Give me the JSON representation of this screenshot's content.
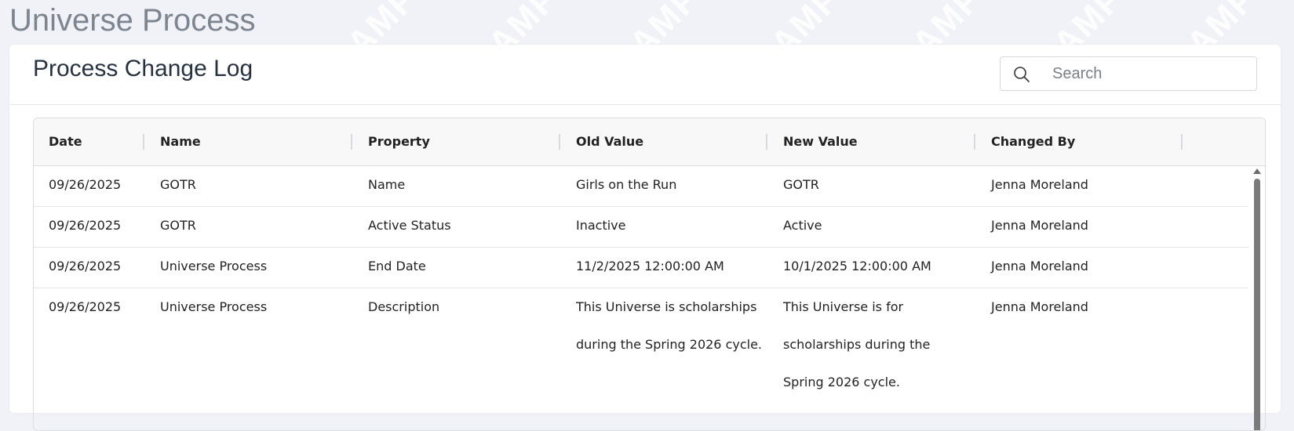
{
  "page": {
    "title": "Universe Process",
    "watermark_text": "SAMPLE"
  },
  "card": {
    "title": "Process Change Log"
  },
  "search": {
    "placeholder": "Search",
    "value": ""
  },
  "table": {
    "columns": [
      "Date",
      "Name",
      "Property",
      "Old Value",
      "New Value",
      "Changed By"
    ],
    "rows": [
      [
        "09/26/2025",
        "GOTR",
        "Name",
        "Girls on the Run",
        "GOTR",
        "Jenna Moreland"
      ],
      [
        "09/26/2025",
        "GOTR",
        "Active Status",
        "Inactive",
        "Active",
        "Jenna Moreland"
      ],
      [
        "09/26/2025",
        "Universe Process",
        "End Date",
        "11/2/2025 12:00:00 AM",
        "10/1/2025 12:00:00 AM",
        "Jenna Moreland"
      ],
      [
        "09/26/2025",
        "Universe Process",
        "Description",
        "This Universe is scholarships during the Spring 2026 cycle.",
        "This Universe is for scholarships during the Spring 2026 cycle.",
        "Jenna Moreland"
      ]
    ]
  },
  "colors": {
    "background": "#f1f2f7",
    "title_gray": "#7d8590",
    "header_bg": "#f8f8f9"
  },
  "icons": {
    "search": "search-icon",
    "scroll_up": "scroll-up-arrow-icon"
  }
}
